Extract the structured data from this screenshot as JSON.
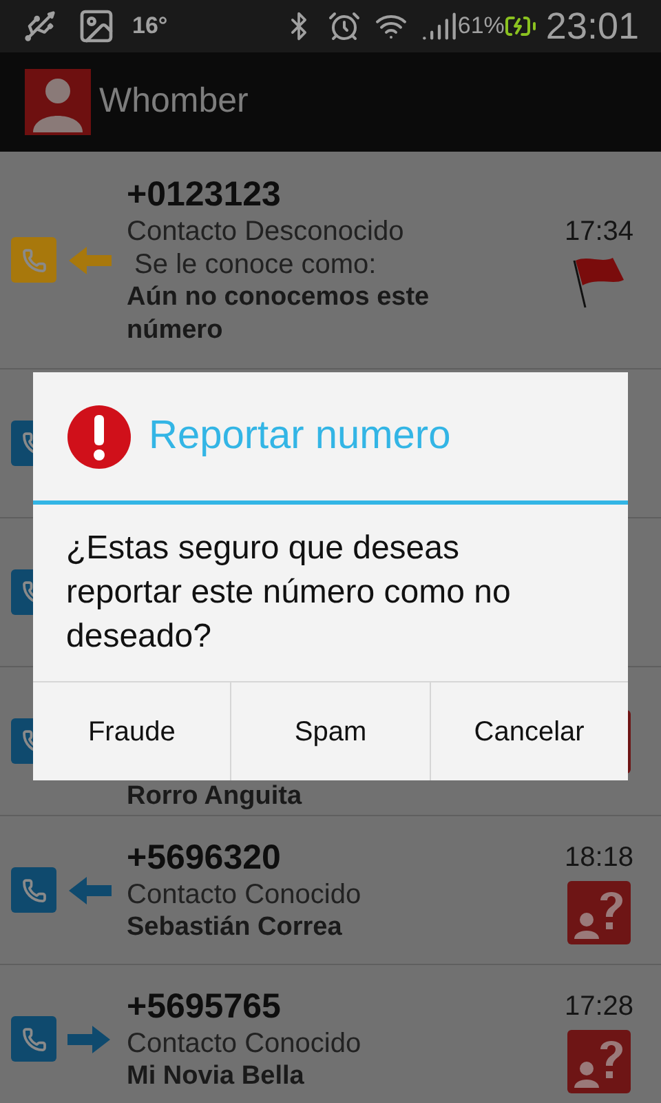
{
  "status_bar": {
    "temperature": "16°",
    "battery": "61%",
    "time": "23:01"
  },
  "app_bar": {
    "title": "Whomber"
  },
  "calls": [
    {
      "number": "+0123123",
      "status": "Contacto Desconocido",
      "alias_label": " Se le conoce como:",
      "name": "Aún no conocemos este número",
      "time": "17:34",
      "arrow": {
        "kind": "in"
      },
      "color": "#a8780c",
      "badge": {
        "kind": "flag"
      }
    },
    {
      "color": "#0f4a6e"
    },
    {
      "color": "#0f4a6e"
    },
    {
      "name": "Rorro Anguita",
      "color": "#0f4a6e",
      "badge": {
        "kind": "unknown"
      }
    },
    {
      "number": "+5696320",
      "status": "Contacto Conocido",
      "name": "Sebastián Correa",
      "time": "18:18",
      "arrow": {
        "kind": "in"
      },
      "color": "#0f4a6e",
      "badge": {
        "kind": "unknown"
      }
    },
    {
      "number": "+5695765",
      "status": "Contacto Conocido",
      "name": "Mi Novia Bella",
      "time": "17:28",
      "arrow": {
        "kind": "out"
      },
      "color": "#0f4a6e",
      "badge": {
        "kind": "unknown"
      }
    }
  ],
  "dialog": {
    "title": "Reportar numero",
    "message": "¿Estas seguro que deseas reportar este número como no deseado?",
    "buttons": [
      "Fraude",
      "Spam",
      "Cancelar"
    ]
  }
}
